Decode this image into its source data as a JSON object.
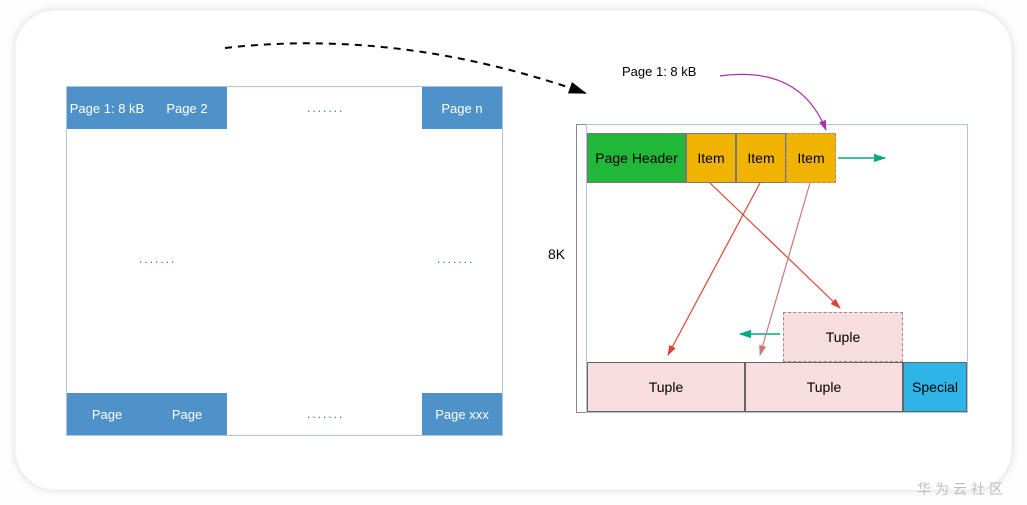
{
  "left": {
    "top_row": [
      "Page 1: 8 kB",
      "Page 2",
      "",
      "Page n"
    ],
    "bot_row": [
      "Page",
      "Page",
      "",
      "Page xxx"
    ],
    "dots": "......."
  },
  "right": {
    "title": "Page 1: 8 kB",
    "size_label": "8K",
    "page_header": "Page Header",
    "items": [
      "Item",
      "Item",
      "Item"
    ],
    "tuples": [
      "Tuple",
      "Tuple",
      "Tuple"
    ],
    "special": "Special"
  },
  "watermark": "华为云社区"
}
